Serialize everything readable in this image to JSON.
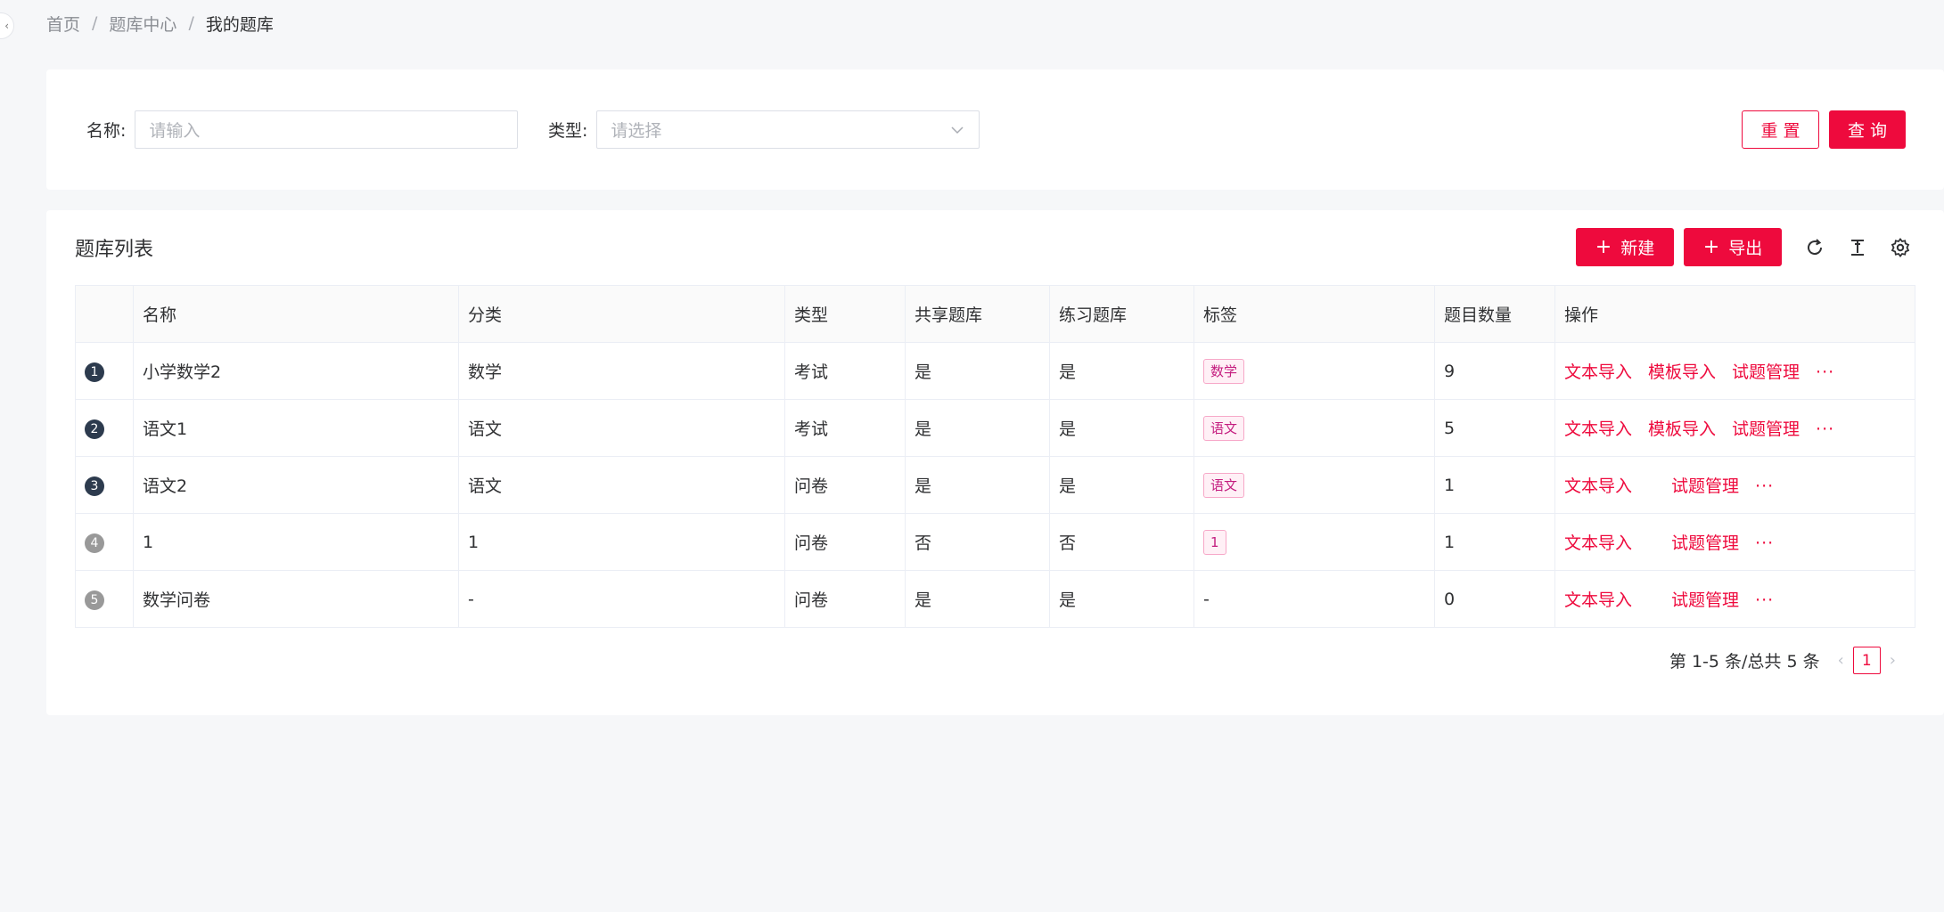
{
  "breadcrumb": {
    "items": [
      "首页",
      "题库中心"
    ],
    "current": "我的题库"
  },
  "filter": {
    "name_label": "名称:",
    "name_placeholder": "请输入",
    "type_label": "类型:",
    "type_placeholder": "请选择",
    "reset_label": "重 置",
    "query_label": "查 询"
  },
  "list": {
    "title": "题库列表",
    "new_label": "新建",
    "export_label": "导出",
    "columns": [
      "名称",
      "分类",
      "类型",
      "共享题库",
      "练习题库",
      "标签",
      "题目数量",
      "操作"
    ],
    "rows": [
      {
        "index": "1",
        "name": "小学数学2",
        "category": "数学",
        "type": "考试",
        "shared": "是",
        "practice": "是",
        "tag": "数学",
        "count": "9",
        "ops": [
          "文本导入",
          "模板导入",
          "试题管理"
        ],
        "more": "···"
      },
      {
        "index": "2",
        "name": "语文1",
        "category": "语文",
        "type": "考试",
        "shared": "是",
        "practice": "是",
        "tag": "语文",
        "count": "5",
        "ops": [
          "文本导入",
          "模板导入",
          "试题管理"
        ],
        "more": "···"
      },
      {
        "index": "3",
        "name": "语文2",
        "category": "语文",
        "type": "问卷",
        "shared": "是",
        "practice": "是",
        "tag": "语文",
        "count": "1",
        "ops": [
          "文本导入",
          "试题管理"
        ],
        "more": "···"
      },
      {
        "index": "4",
        "name": "1",
        "category": "1",
        "type": "问卷",
        "shared": "否",
        "practice": "否",
        "tag": "1",
        "count": "1",
        "ops": [
          "文本导入",
          "试题管理"
        ],
        "more": "···"
      },
      {
        "index": "5",
        "name": "数学问卷",
        "category": "-",
        "type": "问卷",
        "shared": "是",
        "practice": "是",
        "tag": "-",
        "count": "0",
        "ops": [
          "文本导入",
          "试题管理"
        ],
        "more": "···"
      }
    ]
  },
  "pagination": {
    "summary": "第 1-5 条/总共 5 条",
    "current_page": "1",
    "prev": "‹",
    "next": "›"
  },
  "colors": {
    "primary": "#ee0a3d",
    "badge_dark": "#2d3b4e",
    "badge_gray": "#999999"
  },
  "icons": [
    "reload-icon",
    "density-icon",
    "settings-icon",
    "plus-icon",
    "chevron-down-icon"
  ]
}
